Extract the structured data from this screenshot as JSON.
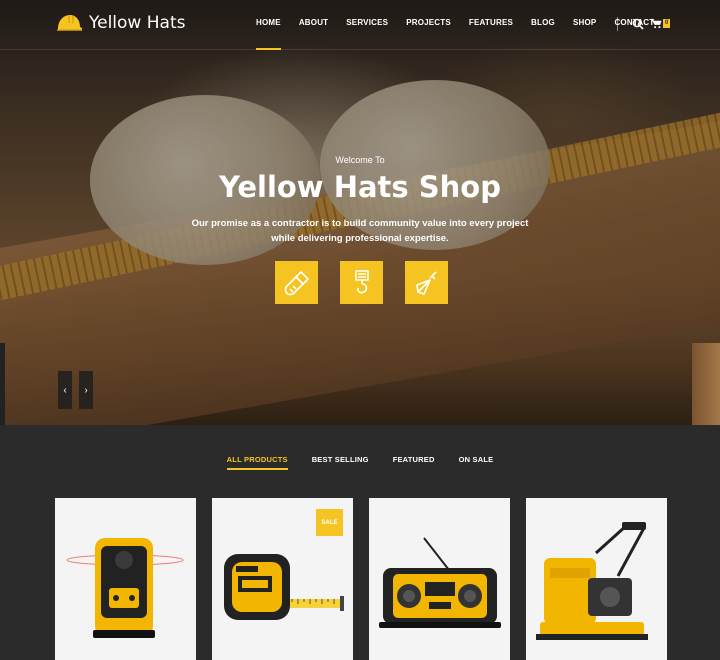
{
  "brand": {
    "name": "Yellow Hats"
  },
  "nav": {
    "items": [
      "HOME",
      "ABOUT",
      "SERVICES",
      "PROJECTS",
      "FEATURES",
      "BLOG",
      "SHOP",
      "CONTACT"
    ],
    "active": "HOME",
    "cart_count": "0"
  },
  "hero": {
    "subtitle": "Welcome To",
    "title": "Yellow Hats Shop",
    "description": "Our promise as a contractor is to build community value into every project while delivering professional expertise.",
    "feature_icons": [
      "paint-brush-icon",
      "crane-hook-icon",
      "trowel-icon"
    ],
    "prev_arrow": "‹",
    "next_arrow": "›"
  },
  "products": {
    "tabs": [
      "ALL PRODUCTS",
      "BEST SELLING",
      "FEATURED",
      "ON SALE"
    ],
    "active_tab": "ALL PRODUCTS",
    "cards": [
      {
        "icon": "rotary-laser-level-icon",
        "badge": ""
      },
      {
        "icon": "tape-measure-icon",
        "badge": "SALE"
      },
      {
        "icon": "jobsite-radio-icon",
        "badge": ""
      },
      {
        "icon": "plate-compactor-icon",
        "badge": ""
      }
    ]
  },
  "colors": {
    "accent": "#f5c423",
    "dark": "#2b2b2b",
    "card": "#f4f4f4"
  }
}
